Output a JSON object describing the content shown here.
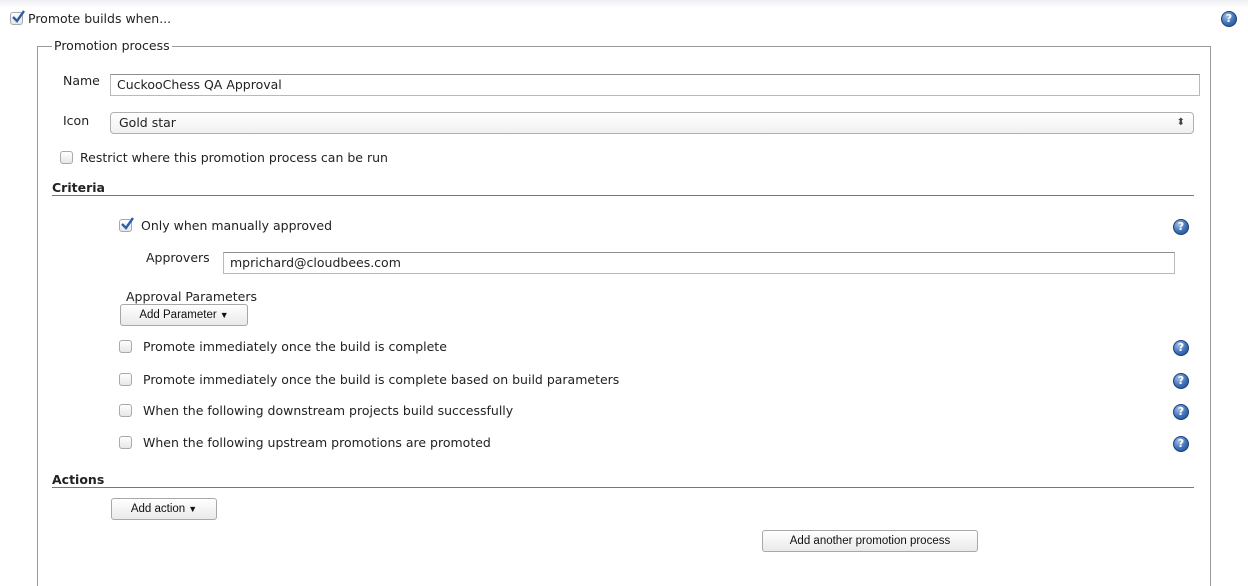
{
  "header": {
    "promote_label": "Promote builds when...",
    "promote_checked": true
  },
  "process": {
    "legend": "Promotion process",
    "name_label": "Name",
    "name_value": "CuckooChess QA Approval",
    "icon_label": "Icon",
    "icon_value": "Gold star",
    "restrict_label": "Restrict where this promotion process can be run",
    "restrict_checked": false
  },
  "criteria": {
    "title": "Criteria",
    "manual_label": "Only when manually approved",
    "manual_checked": true,
    "approvers_label": "Approvers",
    "approvers_value": "mprichard@cloudbees.com",
    "approval_params_label": "Approval Parameters",
    "add_parameter_label": "Add Parameter",
    "options": [
      {
        "label": "Promote immediately once the build is complete",
        "checked": false
      },
      {
        "label": "Promote immediately once the build is complete based on build parameters",
        "checked": false
      },
      {
        "label": "When the following downstream projects build successfully",
        "checked": false
      },
      {
        "label": "When the following upstream promotions are promoted",
        "checked": false
      }
    ]
  },
  "actions": {
    "title": "Actions",
    "add_action_label": "Add action",
    "add_process_label": "Add another promotion process"
  },
  "icons": {
    "help": "help-icon",
    "dropdown": "chevron-down-icon",
    "select_arrows": "updown-arrows-icon",
    "help_glyph": "?",
    "select_glyph": "⬍",
    "caret_glyph": "▼"
  },
  "colors": {
    "check_blue": "#2b5fb0",
    "help_blue": "#3e6fb5",
    "fieldset_border": "#9a9a9a"
  }
}
